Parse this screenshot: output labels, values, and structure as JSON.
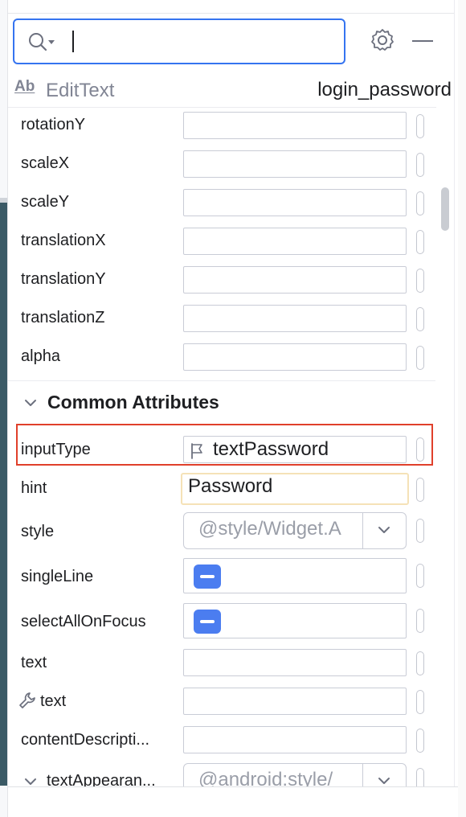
{
  "search": {
    "value": "",
    "placeholder": ""
  },
  "header": {
    "component_type": "EditText",
    "component_id": "login_password"
  },
  "transform_attributes": [
    {
      "label": "rotationY",
      "value": ""
    },
    {
      "label": "scaleX",
      "value": ""
    },
    {
      "label": "scaleY",
      "value": ""
    },
    {
      "label": "translationX",
      "value": ""
    },
    {
      "label": "translationY",
      "value": ""
    },
    {
      "label": "translationZ",
      "value": ""
    },
    {
      "label": "alpha",
      "value": ""
    }
  ],
  "common": {
    "section_title": "Common Attributes",
    "inputType": {
      "label": "inputType",
      "value": "textPassword"
    },
    "hint": {
      "label": "hint",
      "value": "Password"
    },
    "style": {
      "label": "style",
      "value": "@style/Widget.A"
    },
    "singleLine": {
      "label": "singleLine",
      "state": "indeterminate"
    },
    "selectAllOnFocus": {
      "label": "selectAllOnFocus",
      "state": "indeterminate"
    },
    "text": {
      "label": "text",
      "value": ""
    },
    "tools_text": {
      "label": "text",
      "value": ""
    },
    "contentDescription": {
      "label": "contentDescripti...",
      "value": ""
    },
    "textAppearance": {
      "label": "textAppearan...",
      "value": "@android:style/"
    }
  },
  "colors": {
    "accent": "#3574f0",
    "highlight": "#e0402b",
    "checkbox": "#4b7df0"
  },
  "icons": [
    "search-icon",
    "gear-icon",
    "minimize-icon",
    "ab-text-icon",
    "chevron-down-icon",
    "flag-icon",
    "wrench-icon"
  ]
}
